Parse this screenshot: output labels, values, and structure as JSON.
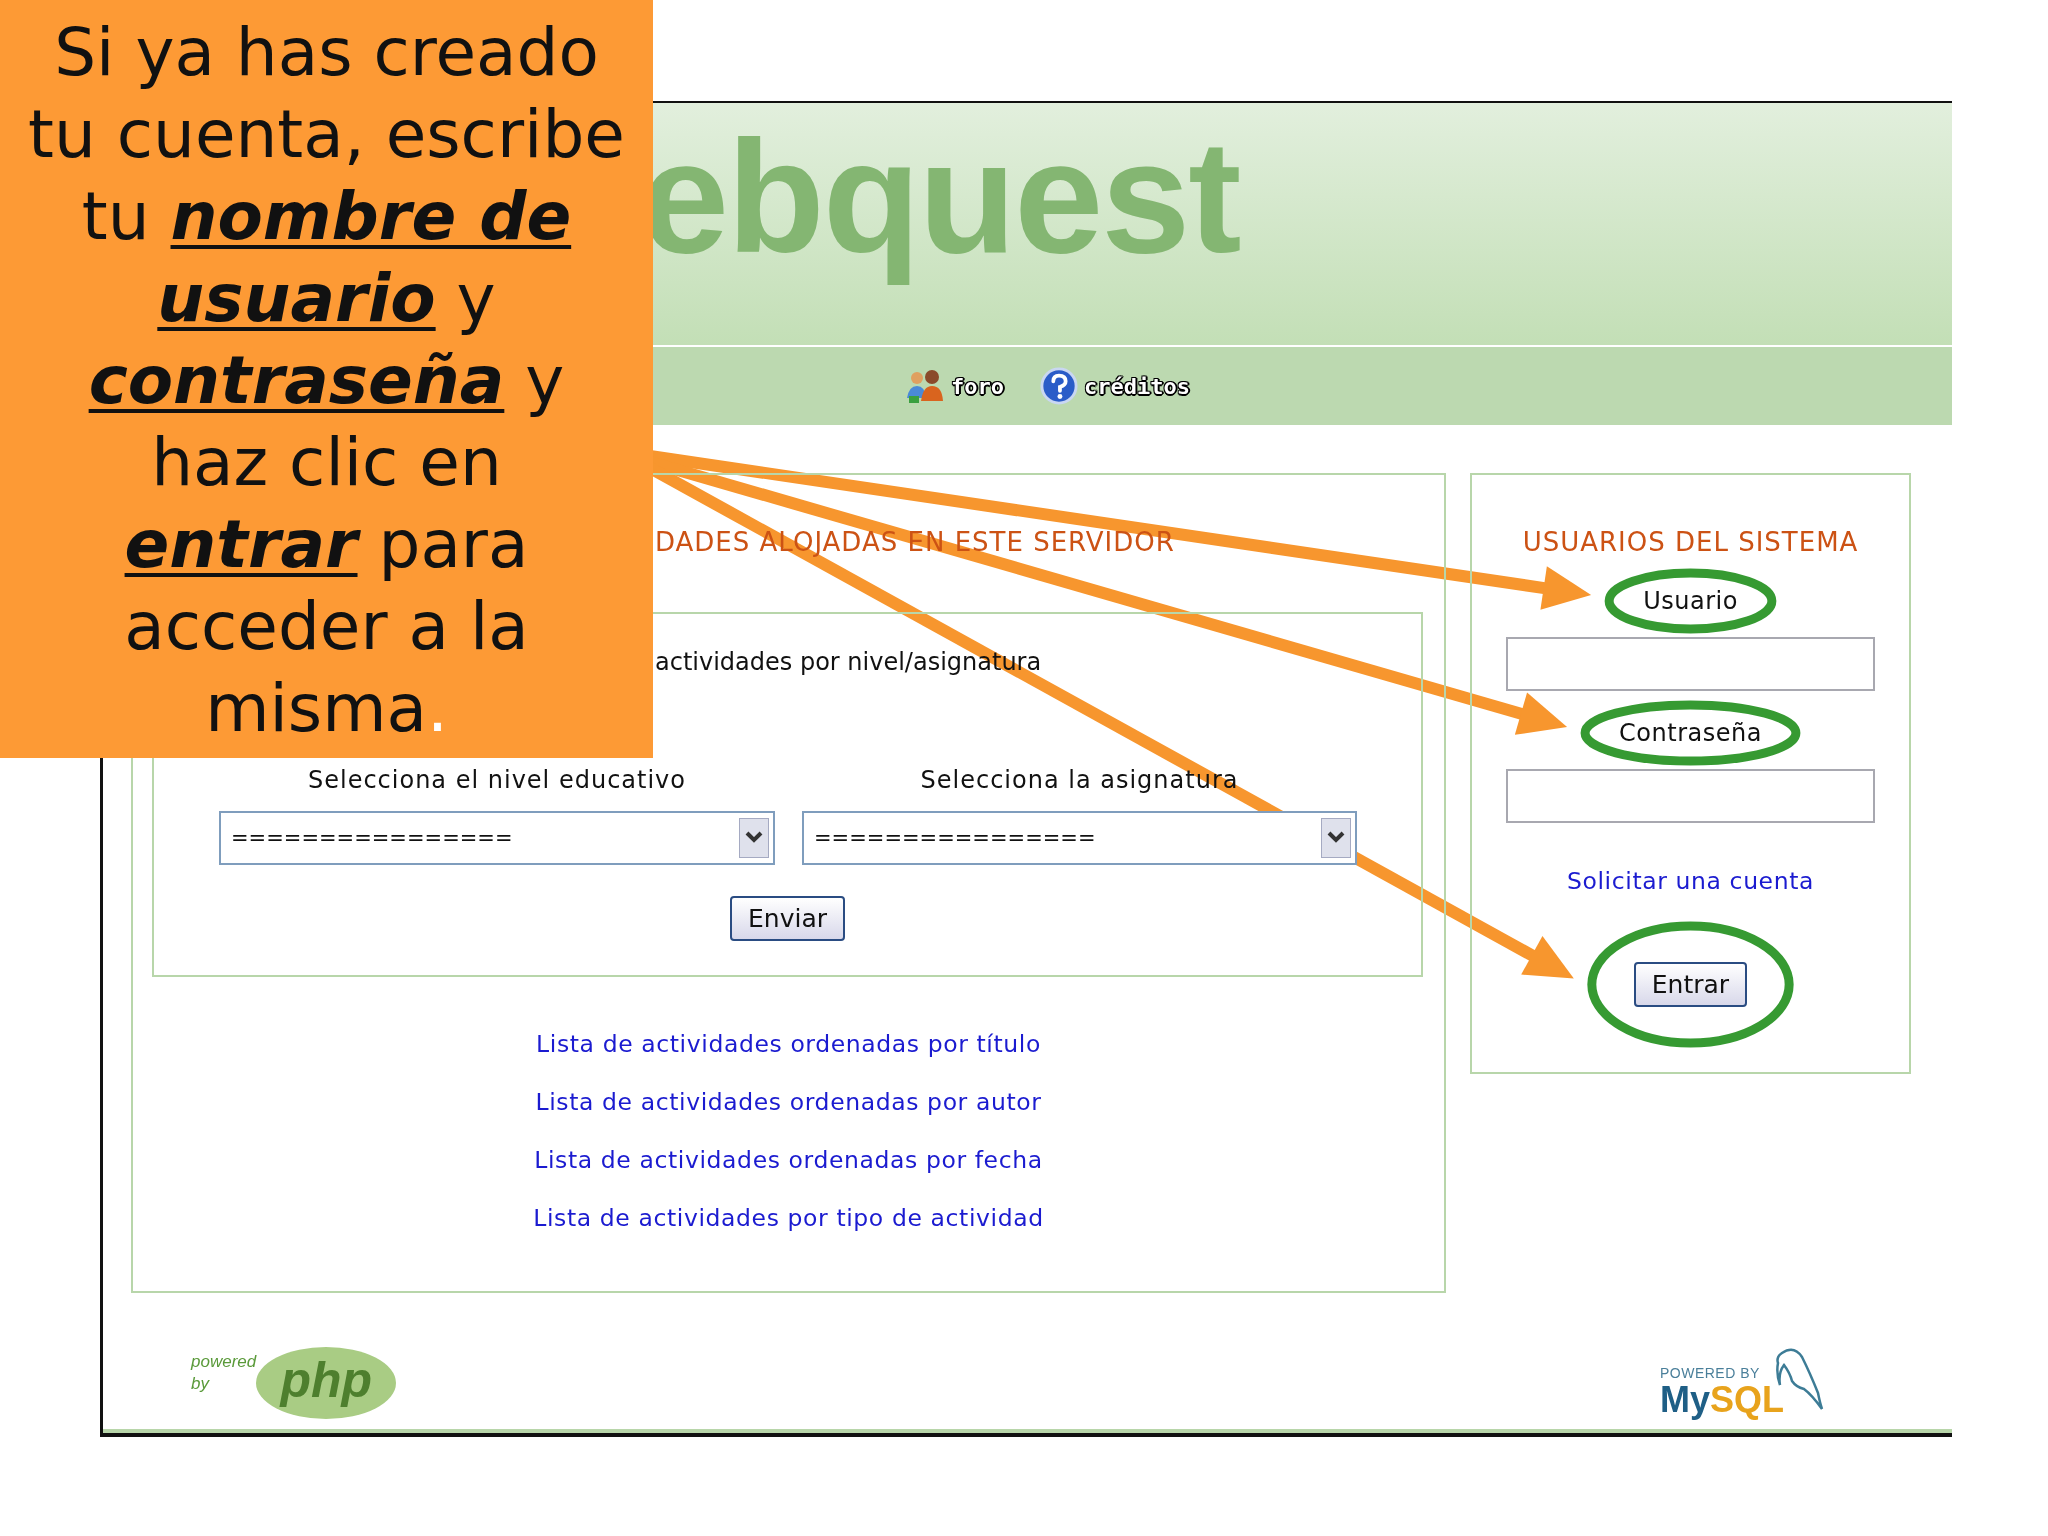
{
  "callout": {
    "lines": [
      [
        {
          "text": "Si ya has creado",
          "kind": "plain"
        }
      ],
      [
        {
          "text": "tu cuenta, escribe",
          "kind": "plain"
        }
      ],
      [
        {
          "text": "tu ",
          "kind": "plain"
        },
        {
          "text": "nombre de",
          "kind": "emphasis"
        }
      ],
      [
        {
          "text": "usuario",
          "kind": "emphasis"
        },
        {
          "text": " y",
          "kind": "plain"
        }
      ],
      [
        {
          "text": "contraseña",
          "kind": "emphasis"
        },
        {
          "text": " y",
          "kind": "plain"
        }
      ],
      [
        {
          "text": "haz clic en",
          "kind": "plain"
        }
      ],
      [
        {
          "text": "entrar",
          "kind": "emphasis"
        },
        {
          "text": " para",
          "kind": "plain"
        }
      ],
      [
        {
          "text": "acceder a la",
          "kind": "plain"
        }
      ],
      [
        {
          "text": "misma",
          "kind": "plain"
        },
        {
          "text": ".",
          "kind": "accent"
        }
      ]
    ]
  },
  "header": {
    "title": "ebquest"
  },
  "nav": [
    {
      "label": "foro"
    },
    {
      "label": "créditos"
    }
  ],
  "activities": {
    "heading": "DADES ALOJADAS EN ESTE SERVIDOR",
    "filter": {
      "heading": "actividades por nivel/asignatura",
      "selects": [
        {
          "label": "Selecciona el nivel educativo",
          "value": "================"
        },
        {
          "label": "Selecciona la asignatura",
          "value": "================"
        }
      ],
      "button": "Enviar"
    },
    "links": [
      "Lista de actividades ordenadas por título",
      "Lista de actividades ordenadas por autor",
      "Lista de actividades ordenadas por fecha",
      "Lista de actividades por tipo de actividad"
    ]
  },
  "login": {
    "heading": "USUARIOS DEL SISTEMA",
    "fields": [
      {
        "label": "Usuario",
        "highlighted": true
      },
      {
        "label": "Contraseña",
        "highlighted": true
      }
    ],
    "link": "Solicitar una cuenta",
    "submit": {
      "label": "Entrar",
      "highlighted": true
    }
  },
  "footer": {
    "php": {
      "caption": [
        "powered",
        "by"
      ],
      "wordmark": "php"
    },
    "mysql": {
      "caption": "POWERED BY",
      "wordmark": [
        "My",
        "SQL"
      ]
    }
  }
}
